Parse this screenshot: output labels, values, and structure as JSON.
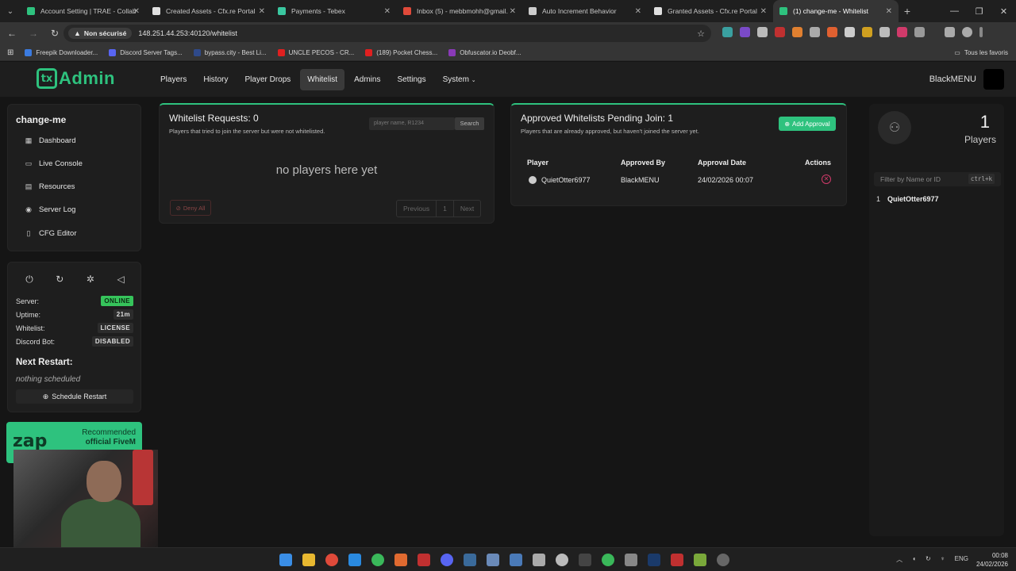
{
  "browser": {
    "tabs": [
      {
        "title": "Account Setting | TRAE - Collab",
        "color": "#2ec27e"
      },
      {
        "title": "Created Assets - Cfx.re Portal",
        "color": "#e0e0e0"
      },
      {
        "title": "Payments - Tebex",
        "color": "#3ac7a0"
      },
      {
        "title": "Inbox (5) - mebbmohh@gmail.",
        "color": "#e04a3a"
      },
      {
        "title": "Auto Increment Behavior",
        "color": "#cccccc"
      },
      {
        "title": "Granted Assets - Cfx.re Portal",
        "color": "#e0e0e0"
      },
      {
        "title": "(1) change-me - Whitelist",
        "color": "#2ec27e"
      }
    ],
    "security": "Non sécurisé",
    "url": "148.251.44.253:40120/whitelist",
    "bookmarks": [
      {
        "label": "Freepik Downloader...",
        "color": "#3b7be0"
      },
      {
        "label": "Discord Server Tags...",
        "color": "#5865f2"
      },
      {
        "label": "bypass.city - Best Li...",
        "color": "#2f4a8a"
      },
      {
        "label": "UNCLE PECOS - CR...",
        "color": "#e02020"
      },
      {
        "label": "(189) Pocket Chess...",
        "color": "#e02020"
      },
      {
        "label": "Obfuscator.io Deobf...",
        "color": "#8a3ab8"
      }
    ],
    "all_bookmarks": "Tous les favoris"
  },
  "header": {
    "logo_icon": "tx",
    "logo_text": "Admin",
    "nav": [
      "Players",
      "History",
      "Player Drops",
      "Whitelist",
      "Admins",
      "Settings",
      "System"
    ],
    "active": "Whitelist",
    "user": "BlackMENU"
  },
  "server": {
    "name": "change-me",
    "nav": [
      {
        "label": "Dashboard",
        "icon": "dashboard-icon"
      },
      {
        "label": "Live Console",
        "icon": "terminal-icon"
      },
      {
        "label": "Resources",
        "icon": "resources-icon"
      },
      {
        "label": "Server Log",
        "icon": "eye-icon"
      },
      {
        "label": "CFG Editor",
        "icon": "file-icon"
      }
    ]
  },
  "status": {
    "server_label": "Server:",
    "server_value": "ONLINE",
    "uptime_label": "Uptime:",
    "uptime_value": "21m",
    "whitelist_label": "Whitelist:",
    "whitelist_value": "LICENSE",
    "discord_label": "Discord Bot:",
    "discord_value": "DISABLED",
    "next_restart_title": "Next Restart:",
    "next_restart_value": "nothing scheduled",
    "schedule_button": "Schedule Restart"
  },
  "promo": {
    "brand": "zap",
    "line1": "Recommended",
    "line2": "official FiveM"
  },
  "requests": {
    "title": "Whitelist Requests: 0",
    "subtitle": "Players that tried to join the server but were not whitelisted.",
    "search_placeholder": "player name, R1234",
    "search_button": "Search",
    "empty": "no players here yet",
    "deny_all": "Deny All",
    "pager": [
      "Previous",
      "1",
      "Next"
    ]
  },
  "approvals": {
    "title": "Approved Whitelists Pending Join: 1",
    "subtitle": "Players that are already approved, but haven't joined the server yet.",
    "add_button": "Add Approval",
    "columns": [
      "Player",
      "Approved By",
      "Approval Date",
      "Actions"
    ],
    "rows": [
      {
        "player": "QuietOtter6977",
        "approved_by": "BlackMENU",
        "date": "24/02/2026 00:07"
      }
    ]
  },
  "players": {
    "count": "1",
    "label": "Players",
    "filter_placeholder": "Filter by Name or ID",
    "shortcut": "ctrl+k",
    "list": [
      {
        "id": "1",
        "name": "QuietOtter6977"
      }
    ]
  },
  "taskbar": {
    "lang": "ENG",
    "time": "00:08",
    "date": "24/02/2026"
  }
}
